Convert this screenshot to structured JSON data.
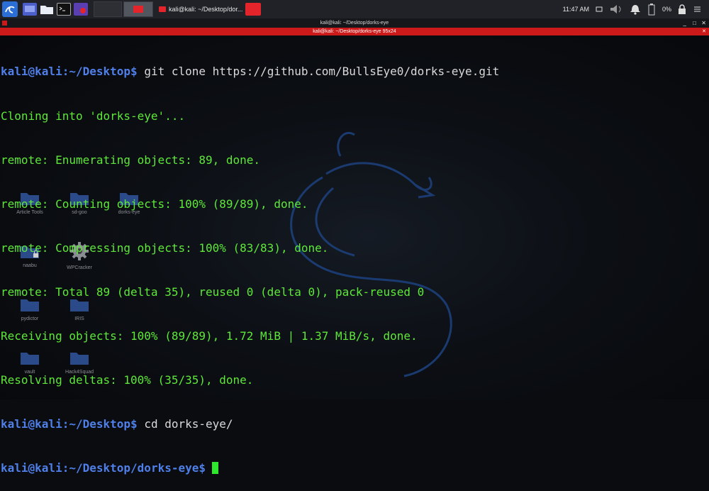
{
  "panel": {
    "task_label": "kali@kali: ~/Desktop/dor...",
    "clock": "11:47 AM",
    "battery": "0%"
  },
  "terminal": {
    "title": "kali@kali: ~/Desktop/dorks-eye",
    "tab_label": "kali@kali: ~/Desktop/dorks-eye 95x24",
    "prompt_user": "kali@kali",
    "lines": [
      {
        "path": "~/Desktop",
        "cmd": "git clone https://github.com/BullsEye0/dorks-eye.git"
      },
      {
        "text": "Cloning into 'dorks-eye'..."
      },
      {
        "text": "remote: Enumerating objects: 89, done."
      },
      {
        "text": "remote: Counting objects: 100% (89/89), done."
      },
      {
        "text": "remote: Compressing objects: 100% (83/83), done."
      },
      {
        "text": "remote: Total 89 (delta 35), reused 0 (delta 0), pack-reused 0"
      },
      {
        "text": "Receiving objects: 100% (89/89), 1.72 MiB | 1.37 MiB/s, done."
      },
      {
        "text": "Resolving deltas: 100% (35/35), done."
      },
      {
        "path": "~/Desktop",
        "cmd": "cd dorks-eye/"
      },
      {
        "path": "~/Desktop/dorks-eye",
        "cmd": ""
      }
    ]
  },
  "desktop_icons": [
    {
      "label": "Article Tools",
      "icon": "folder-icon"
    },
    {
      "label": "sd-goo",
      "icon": "folder-icon"
    },
    {
      "label": "dorks-eye",
      "icon": "folder-icon"
    },
    {
      "label": "naabu",
      "icon": "locked-folder-icon"
    },
    {
      "label": "WPCracker",
      "icon": "gear-icon"
    },
    {
      "label": "pydictor",
      "icon": "folder-icon"
    },
    {
      "label": "IRIS",
      "icon": "folder-icon"
    },
    {
      "label": "vault",
      "icon": "folder-icon"
    },
    {
      "label": "Hack4Squad",
      "icon": "folder-icon"
    }
  ],
  "colors": {
    "output": "#5ee83a",
    "prompt": "#4f7fe8",
    "command": "#dadada",
    "accent_red": "#cc1a1a"
  }
}
